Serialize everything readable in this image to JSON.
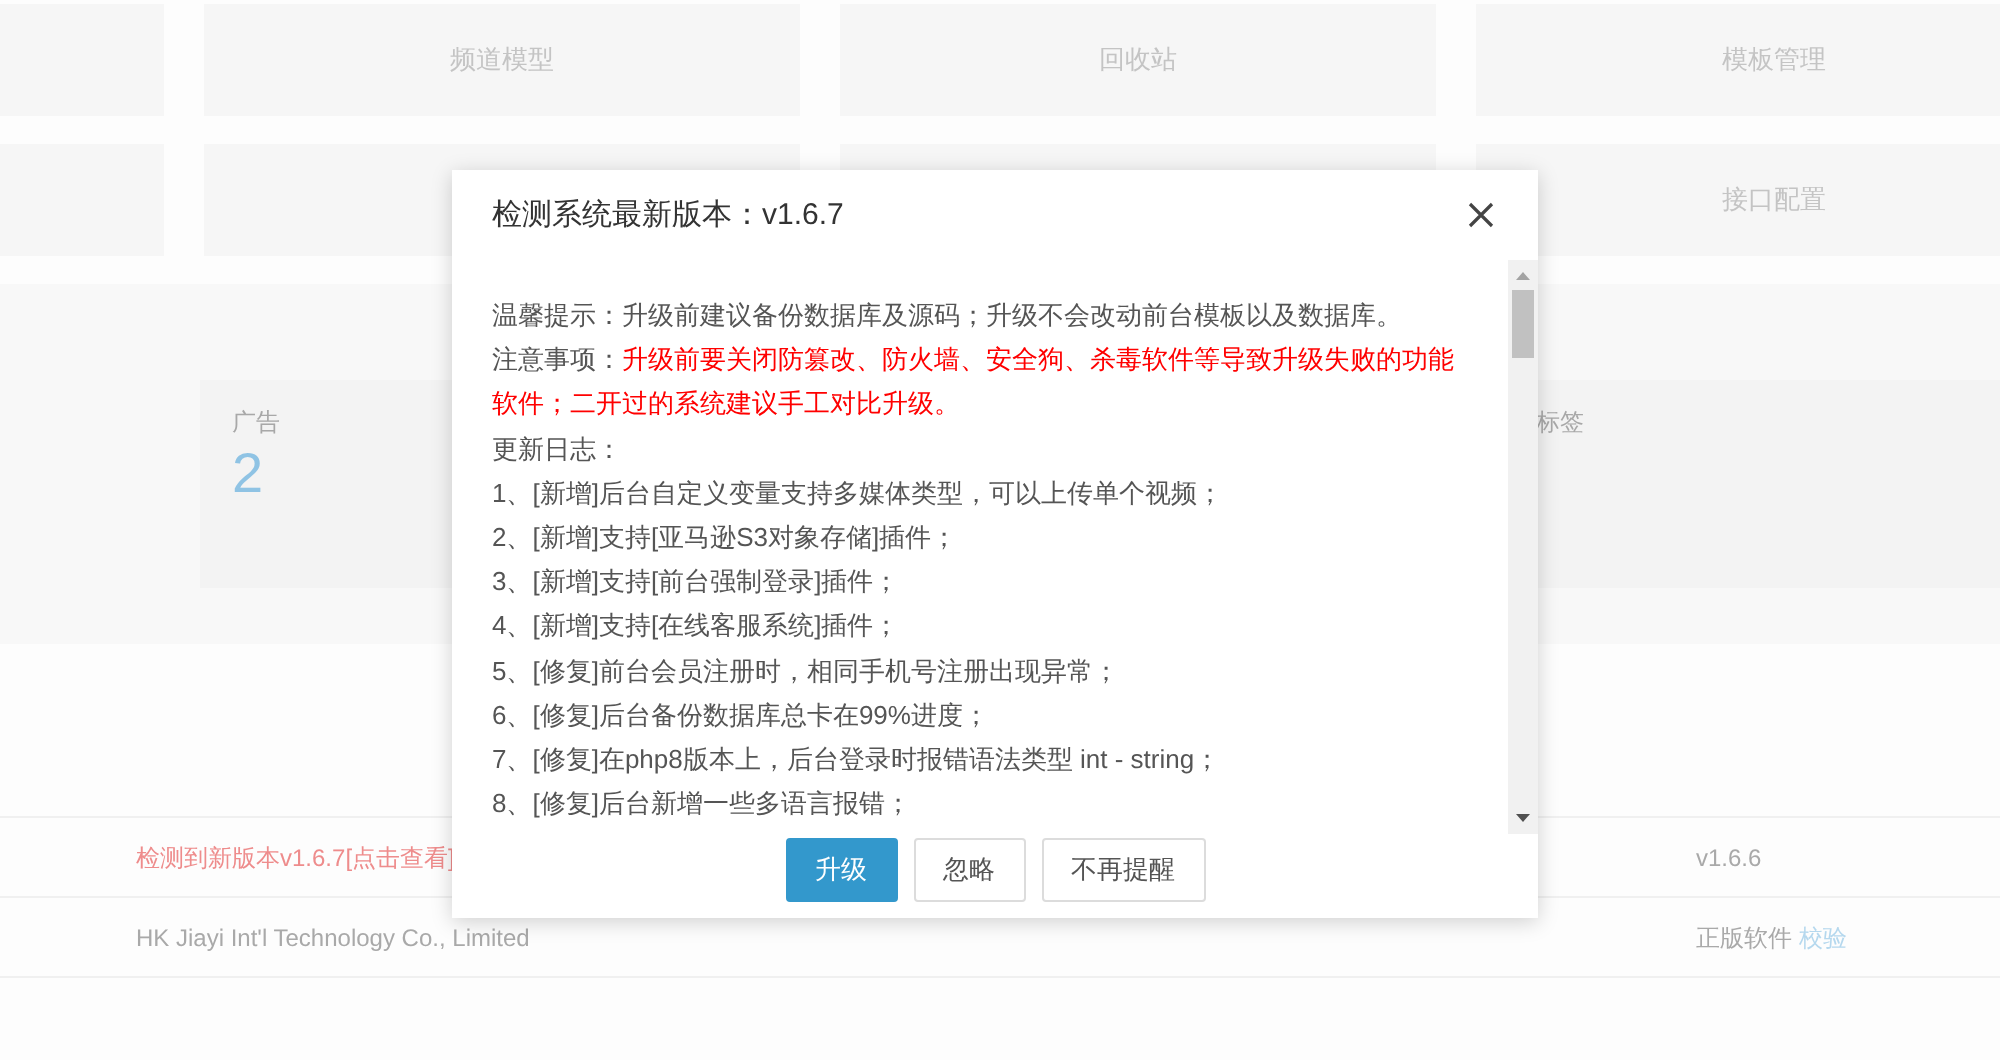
{
  "shortcuts": {
    "row_1": [
      "频道模型",
      "回收站",
      "模板管理"
    ],
    "row_2": [
      "接口配置"
    ]
  },
  "stats": [
    {
      "label": "广告",
      "value": "2"
    },
    {
      "label": "标签"
    }
  ],
  "system_info": {
    "update_notice": "检测到新版本v1.6.7[点击查看]",
    "version": "v1.6.6",
    "company": "HK Jiayi Int'l Technology Co., Limited",
    "license": "正版软件",
    "verify_link": "校验"
  },
  "dialog": {
    "title": "检测系统最新版本：v1.6.7",
    "notes": [
      {
        "label": "温馨提示：",
        "text": "升级前建议备份数据库及源码；升级不会改动前台模板以及数据库。",
        "kind": "normal"
      },
      {
        "label": "注意事项：",
        "text": "升级前要关闭防篡改、防火墙、安全狗、杀毒软件等导致升级失败的功能软件；二开过的系统建议手工对比升级。",
        "kind": "warning"
      }
    ],
    "changelog_heading": "更新日志：",
    "changelog": [
      "1、[新增]后台自定义变量支持多媒体类型，可以上传单个视频；",
      "2、[新增]支持[亚马逊S3对象存储]插件；",
      "3、[新增]支持[前台强制登录]插件；",
      "4、[新增]支持[在线客服系统]插件；",
      "5、[修复]前台会员注册时，相同手机号注册出现异常；",
      "6、[修复]后台备份数据库总卡在99%进度；",
      "7、[修复]在php8版本上，后台登录时报错语法类型 int - string；",
      "8、[修复]后台新增一些多语言报错；"
    ],
    "buttons": [
      {
        "label": "升级",
        "kind": "primary"
      },
      {
        "label": "忽略",
        "kind": "default"
      },
      {
        "label": "不再提醒",
        "kind": "default"
      }
    ]
  }
}
